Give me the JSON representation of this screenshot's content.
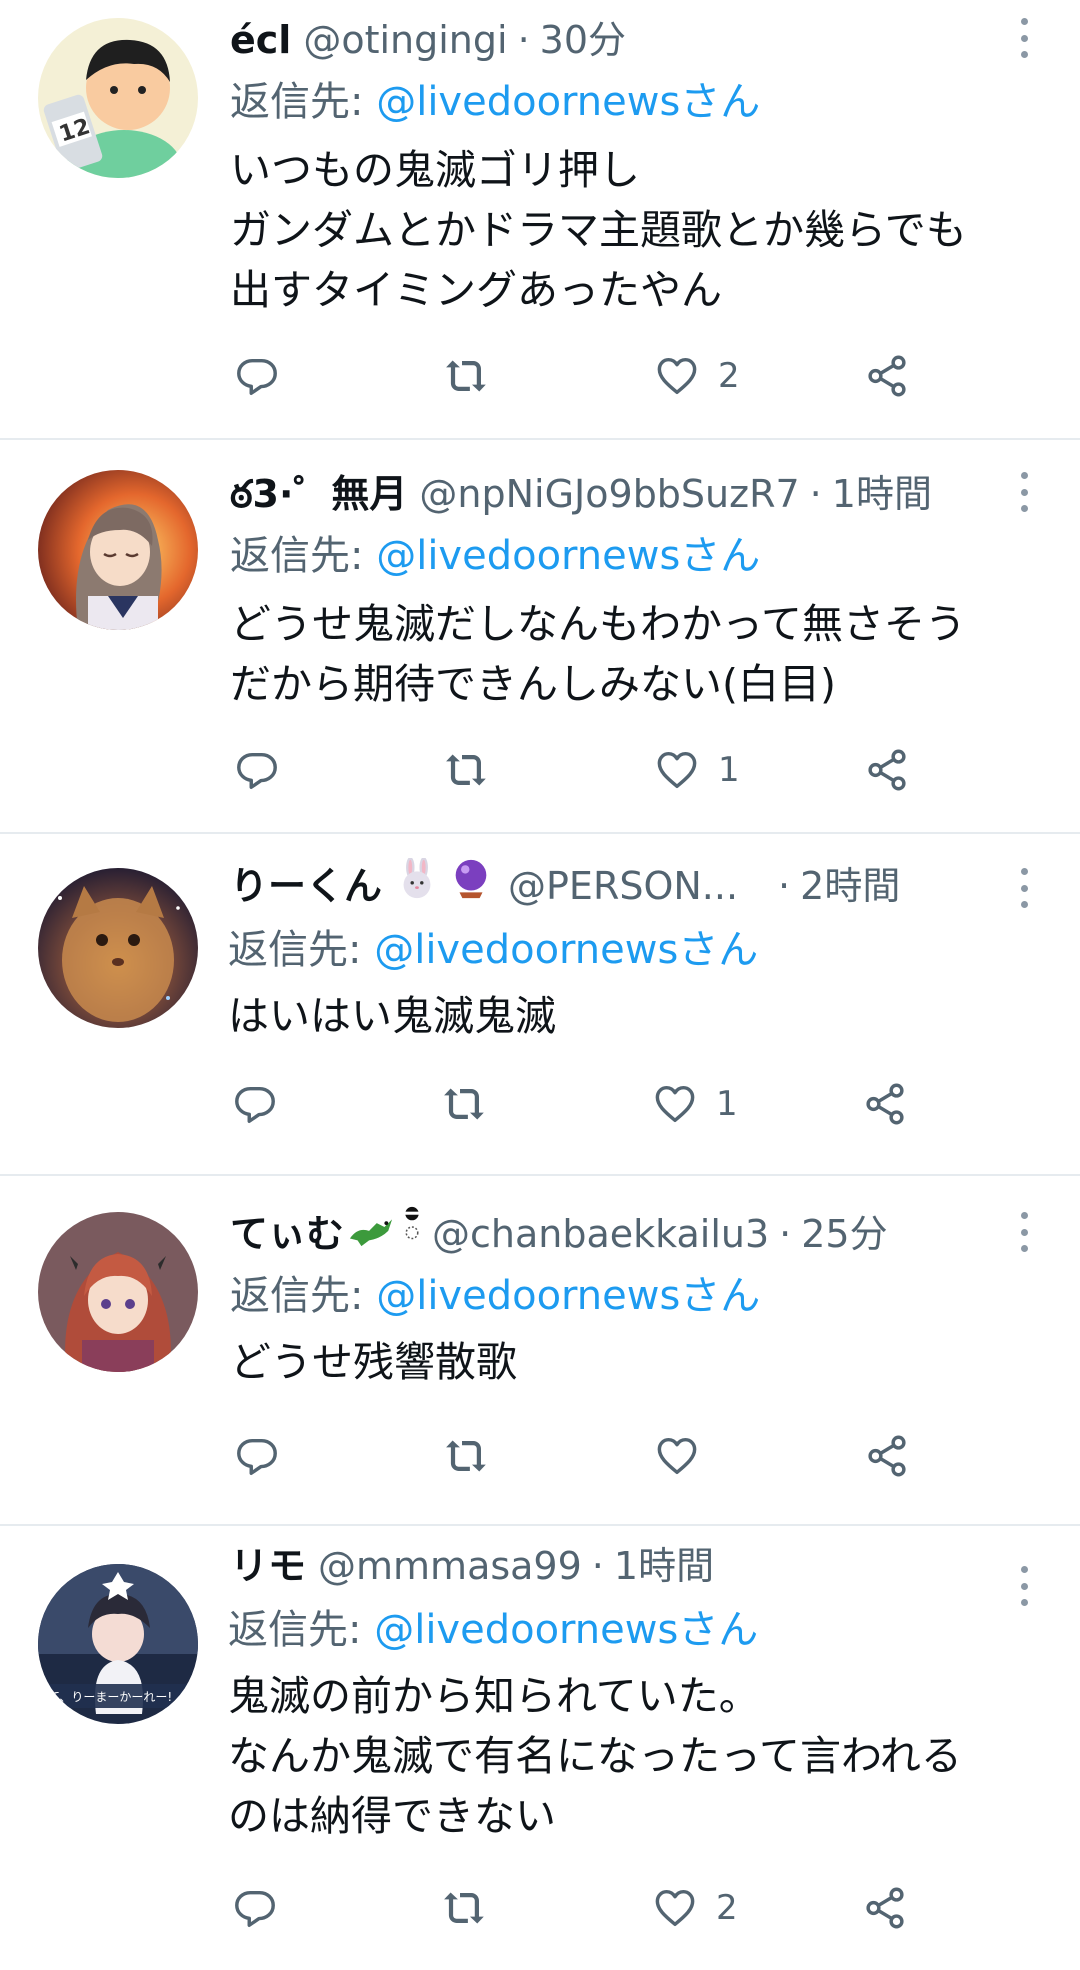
{
  "reply_prefix": "返信先: ",
  "tweets": [
    {
      "display_name": "écl",
      "handle": "@otingingi",
      "separator": "·",
      "time": "30分",
      "reply_to": "@livedoornewsさん",
      "lines": [
        "いつもの鬼滅ゴリ押し",
        "ガンダムとかドラマ主題歌とか幾らでも",
        "出すタイミングあったやん"
      ],
      "like_count": "2"
    },
    {
      "display_name": "ఠ3·゜無月",
      "handle": "@npNiGJo9bbSuzR7",
      "separator": "·",
      "time": "1時間",
      "reply_to": "@livedoornewsさん",
      "lines": [
        "どうせ鬼滅だしなんもわかって無さそう",
        "だから期待できんしみない(白目)"
      ],
      "like_count": "1"
    },
    {
      "display_name": "りーくん",
      "handle": "@PERSON...",
      "separator": "·",
      "time": "2時間",
      "reply_to": "@livedoornewsさん",
      "lines": [
        "はいはい鬼滅鬼滅"
      ],
      "like_count": "1"
    },
    {
      "display_name": "てぃむ",
      "handle": "@chanbaekkailu3",
      "separator": "·",
      "time": "25分",
      "reply_to": "@livedoornewsさん",
      "lines": [
        "どうせ残響散歌"
      ],
      "like_count": ""
    },
    {
      "display_name": "リモ",
      "handle": "@mmmasa99",
      "separator": "·",
      "time": "1時間",
      "reply_to": "@livedoornewsさん",
      "lines": [
        "鬼滅の前から知られていた。",
        "なんか鬼滅で有名になったって言われる",
        "のは納得できない"
      ],
      "like_count": "2"
    }
  ],
  "icons": {
    "reply": "reply-icon",
    "retweet": "retweet-icon",
    "like": "like-icon",
    "share": "share-icon",
    "more": "more-icon"
  },
  "colors": {
    "mention": "#1d9bf0",
    "secondary_text": "#536471",
    "divider": "#e6ebef"
  }
}
